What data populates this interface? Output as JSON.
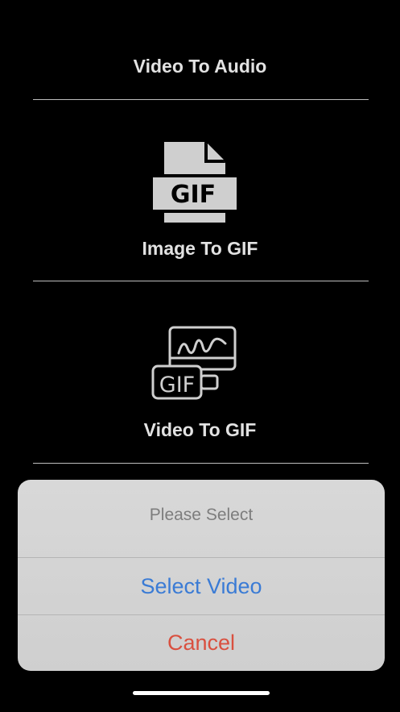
{
  "menu": {
    "items": [
      {
        "label": "Video To Audio",
        "icon": "audio-icon"
      },
      {
        "label": "Image To GIF",
        "icon": "gif-file-icon"
      },
      {
        "label": "Video To GIF",
        "icon": "video-gif-icon"
      }
    ],
    "gif_badge_text": "GIF"
  },
  "action_sheet": {
    "title": "Please Select",
    "select_video_label": "Select Video",
    "cancel_label": "Cancel"
  },
  "colors": {
    "background": "#000000",
    "sheet": "#d4d4d4",
    "action_blue": "#3a7bd5",
    "cancel_red": "#d9503f",
    "icon_gray": "#cfcfcf"
  }
}
